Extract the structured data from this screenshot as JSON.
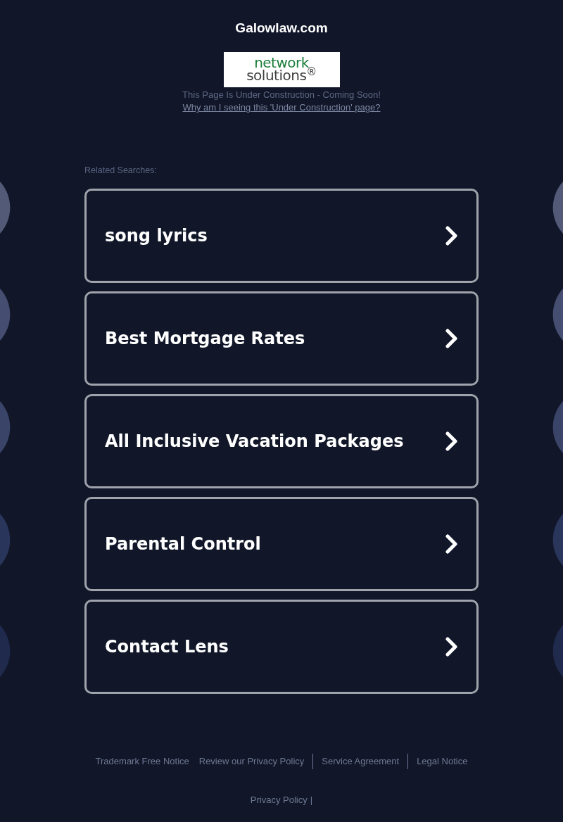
{
  "header": {
    "title": "Galowlaw.com",
    "logo": {
      "line_1": "network",
      "line_2": "solutions$^{®}$"
    },
    "notice": "This Page Is Under Construction - Coming Soon!",
    "link": "Why am I seeing this 'Under Construction' page?"
  },
  "related_searches": {
    "label": "Related Searches:",
    "items": [
      "song lyrics",
      "Best Mortgage Rates",
      "All Inclusive Vacation Packages",
      "Parental Control",
      "Contact Lens"
    ]
  },
  "footer": {
    "links": [
      {
        "label": "Trademark Free Notice",
        "separator_before": false
      },
      {
        "label": "Review our Privacy Policy",
        "separator_before": false
      },
      {
        "label": "Service Agreement",
        "separator_before": true
      },
      {
        "label": "Legal Notice",
        "separator_before": true
      }
    ],
    "bottom_link": "Privacy Policy",
    "bottom_separator": "|"
  }
}
